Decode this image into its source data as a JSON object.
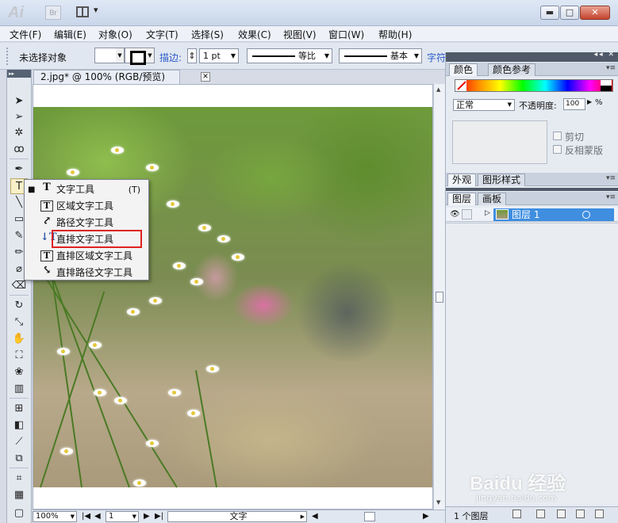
{
  "app": {
    "logo": "Ai",
    "bridge_label": "Br",
    "workspace_icon": "workspace-switcher-icon"
  },
  "window_controls": {
    "minimize": "▬",
    "maximize": "□",
    "close": "✕"
  },
  "menu": [
    "文件(F)",
    "编辑(E)",
    "对象(O)",
    "文字(T)",
    "选择(S)",
    "效果(C)",
    "视图(V)",
    "窗口(W)",
    "帮助(H)"
  ],
  "control_bar": {
    "selection_status": "未选择对象",
    "stroke_link": "描边:",
    "stroke_weight": "1 pt",
    "profile_label": "等比",
    "brush_label": "基本",
    "char_link": "字符"
  },
  "document": {
    "tab_title": "2.jpg* @ 100% (RGB/预览)",
    "close": "✕"
  },
  "tools": [
    "selection-tool",
    "direct-selection-tool",
    "magic-wand-tool",
    "lasso-tool",
    "pen-tool",
    "type-tool",
    "line-tool",
    "rectangle-tool",
    "paintbrush-tool",
    "pencil-tool",
    "eraser-tool",
    "rotate-tool",
    "scale-tool",
    "warp-tool",
    "free-transform-tool",
    "symbol-sprayer-tool",
    "column-graph-tool",
    "mesh-tool",
    "gradient-tool",
    "eyedropper-tool",
    "blend-tool",
    "live-paint-tool",
    "artboard-tool",
    "slice-tool",
    "hand-tool",
    "zoom-tool"
  ],
  "type_flyout": {
    "items": [
      {
        "label": "文字工具",
        "shortcut": "(T)",
        "icon": "T",
        "current": true
      },
      {
        "label": "区域文字工具",
        "shortcut": "",
        "icon": "T"
      },
      {
        "label": "路径文字工具",
        "shortcut": "",
        "icon": "⤤"
      },
      {
        "label": "直排文字工具",
        "shortcut": "",
        "icon": "↓T",
        "highlighted": true
      },
      {
        "label": "直排区域文字工具",
        "shortcut": "",
        "icon": "T"
      },
      {
        "label": "直排路径文字工具",
        "shortcut": "",
        "icon": "⤥"
      }
    ],
    "current_marker": "■"
  },
  "status_bar": {
    "zoom": "100%",
    "artboard": "1",
    "tool_name": "文字"
  },
  "panels": {
    "color_tabs": [
      "颜色",
      "颜色参考"
    ],
    "transparency": {
      "blend_mode": "正常",
      "opacity_label": "不透明度:",
      "opacity_value": "100",
      "opacity_unit": "%",
      "clip_label": "剪切",
      "invert_mask_label": "反相蒙版"
    },
    "appearance_tabs": [
      "外观",
      "图形样式"
    ],
    "layers_tabs": [
      "图层",
      "画板"
    ],
    "layer": {
      "name": "图层 1"
    },
    "layer_count": "1 个图层"
  },
  "watermark": {
    "brand": "Baidu 经验",
    "url": "jingyan.baidu.com"
  },
  "colors": {
    "selection_blue": "#3f8ee0",
    "highlight_red": "#e02020",
    "link_blue": "#2b5bc9"
  }
}
